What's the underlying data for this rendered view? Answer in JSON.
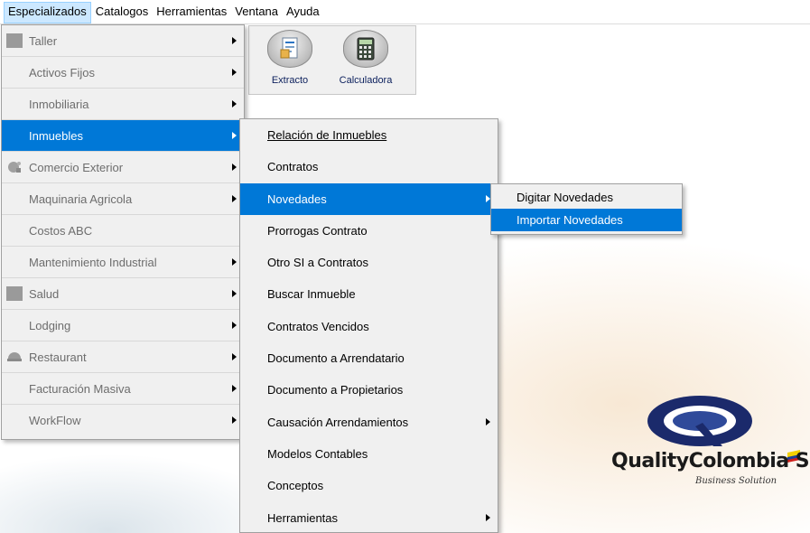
{
  "menubar": {
    "items": [
      "Especializados",
      "Catalogos",
      "Herramientas",
      "Ventana",
      "Ayuda"
    ]
  },
  "toolbar": {
    "buttons": [
      {
        "label": "Extracto",
        "icon": "document-icon"
      },
      {
        "label": "Calculadora",
        "icon": "calculator-icon"
      }
    ]
  },
  "menu1": {
    "items": [
      {
        "label": "Taller",
        "icon": "gray-square-icon",
        "submenu": true
      },
      {
        "label": "Activos Fijos",
        "submenu": true
      },
      {
        "label": "Inmobiliaria",
        "submenu": true
      },
      {
        "label": "Inmuebles",
        "submenu": true,
        "selected": true
      },
      {
        "label": "Comercio Exterior",
        "icon": "globe-icon",
        "submenu": true
      },
      {
        "label": "Maquinaria Agricola",
        "submenu": true
      },
      {
        "label": "Costos ABC",
        "submenu": false
      },
      {
        "label": "Mantenimiento Industrial",
        "submenu": true
      },
      {
        "label": "Salud",
        "icon": "gray-square-icon",
        "submenu": true
      },
      {
        "label": "Lodging",
        "submenu": true
      },
      {
        "label": "Restaurant",
        "icon": "restaurant-icon",
        "submenu": true
      },
      {
        "label": "Facturación Masiva",
        "submenu": true
      },
      {
        "label": "WorkFlow",
        "submenu": true
      }
    ]
  },
  "menu2": {
    "items": [
      {
        "label": "Relación de Inmuebles",
        "underline_first": true
      },
      {
        "label": "Contratos"
      },
      {
        "label": "Novedades",
        "submenu": true,
        "selected": true
      },
      {
        "label": "Prorrogas Contrato"
      },
      {
        "label": "Otro SI a Contratos"
      },
      {
        "label": "Buscar Inmueble"
      },
      {
        "label": "Contratos Vencidos"
      },
      {
        "label": "Documento a Arrendatario"
      },
      {
        "label": "Documento a Propietarios"
      },
      {
        "label": "Causación Arrendamientos",
        "submenu": true
      },
      {
        "label": "Modelos Contables"
      },
      {
        "label": "Conceptos"
      },
      {
        "label": "Herramientas",
        "submenu": true
      }
    ]
  },
  "menu3": {
    "items": [
      {
        "label": "Digitar Novedades"
      },
      {
        "label": "Importar Novedades",
        "selected": true
      }
    ]
  },
  "logo": {
    "name": "QualityColombia S.A.",
    "tagline": "Business Solution"
  },
  "colors": {
    "selection": "#0078d7",
    "menu_bg": "#f0f0f0",
    "disabled_text": "#6d6d6d",
    "logo_navy": "#1b2a6b"
  }
}
